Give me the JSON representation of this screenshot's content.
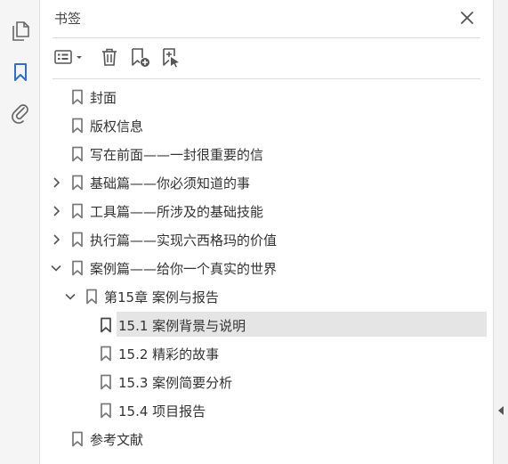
{
  "panel": {
    "title": "书签"
  },
  "rail": {
    "icons": [
      "pages-icon",
      "bookmark-icon",
      "attachment-icon"
    ],
    "active_color": "#2d6ed0"
  },
  "toolbar": {
    "buttons": [
      "options-menu-icon",
      "delete-icon",
      "new-bookmark-icon",
      "add-bookmark-from-structure-icon"
    ]
  },
  "bookmarks": [
    {
      "label": "封面",
      "level": 0,
      "expander": "none"
    },
    {
      "label": "版权信息",
      "level": 0,
      "expander": "none"
    },
    {
      "label": "写在前面——一封很重要的信",
      "level": 0,
      "expander": "none"
    },
    {
      "label": "基础篇——你必须知道的事",
      "level": 0,
      "expander": "collapsed"
    },
    {
      "label": "工具篇——所涉及的基础技能",
      "level": 0,
      "expander": "collapsed"
    },
    {
      "label": "执行篇——实现六西格玛的价值",
      "level": 0,
      "expander": "collapsed"
    },
    {
      "label": "案例篇——给你一个真实的世界",
      "level": 0,
      "expander": "expanded"
    },
    {
      "label": "第15章 案例与报告",
      "level": 1,
      "expander": "expanded"
    },
    {
      "label": "15.1 案例背景与说明",
      "level": 2,
      "expander": "none",
      "selected": true
    },
    {
      "label": "15.2 精彩的故事",
      "level": 2,
      "expander": "none"
    },
    {
      "label": "15.3 案例简要分析",
      "level": 2,
      "expander": "none"
    },
    {
      "label": "15.4 项目报告",
      "level": 2,
      "expander": "none"
    },
    {
      "label": "参考文献",
      "level": 0,
      "expander": "none"
    }
  ]
}
